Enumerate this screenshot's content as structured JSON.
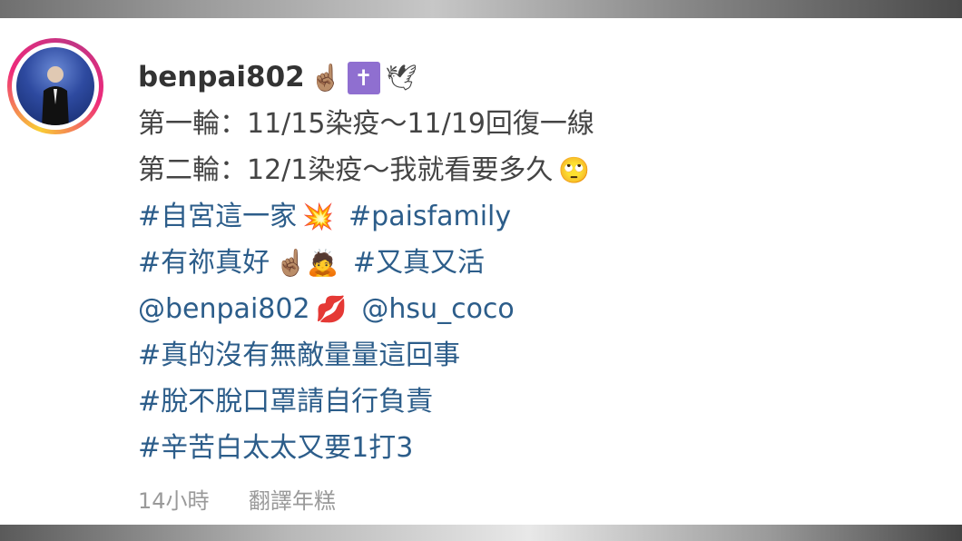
{
  "post": {
    "username": "benpai802",
    "username_emojis": [
      "☝🏽",
      "✝",
      "🕊"
    ],
    "lines": [
      "第一輪：11/15染疫～11/19回復一線",
      "第二輪：12/1染疫～我就看要多久"
    ],
    "line2_emoji": "🙄",
    "hashtags": {
      "h1": "#自宮這一家",
      "h1_emoji": "💥",
      "h2": "#paisfamily",
      "h3": "#有祢真好",
      "h3_emojis": "☝🏽🙇",
      "h4": "#又真又活",
      "mention1": "@benpai802",
      "mention_emoji": "💋",
      "mention2": "@hsu_coco",
      "h5": "#真的沒有無敵量量這回事",
      "h6": "#脫不脫口罩請自行負責",
      "h7": "#辛苦白太太又要1打3"
    },
    "timestamp": "14小時",
    "translate_label": "翻譯年糕"
  }
}
